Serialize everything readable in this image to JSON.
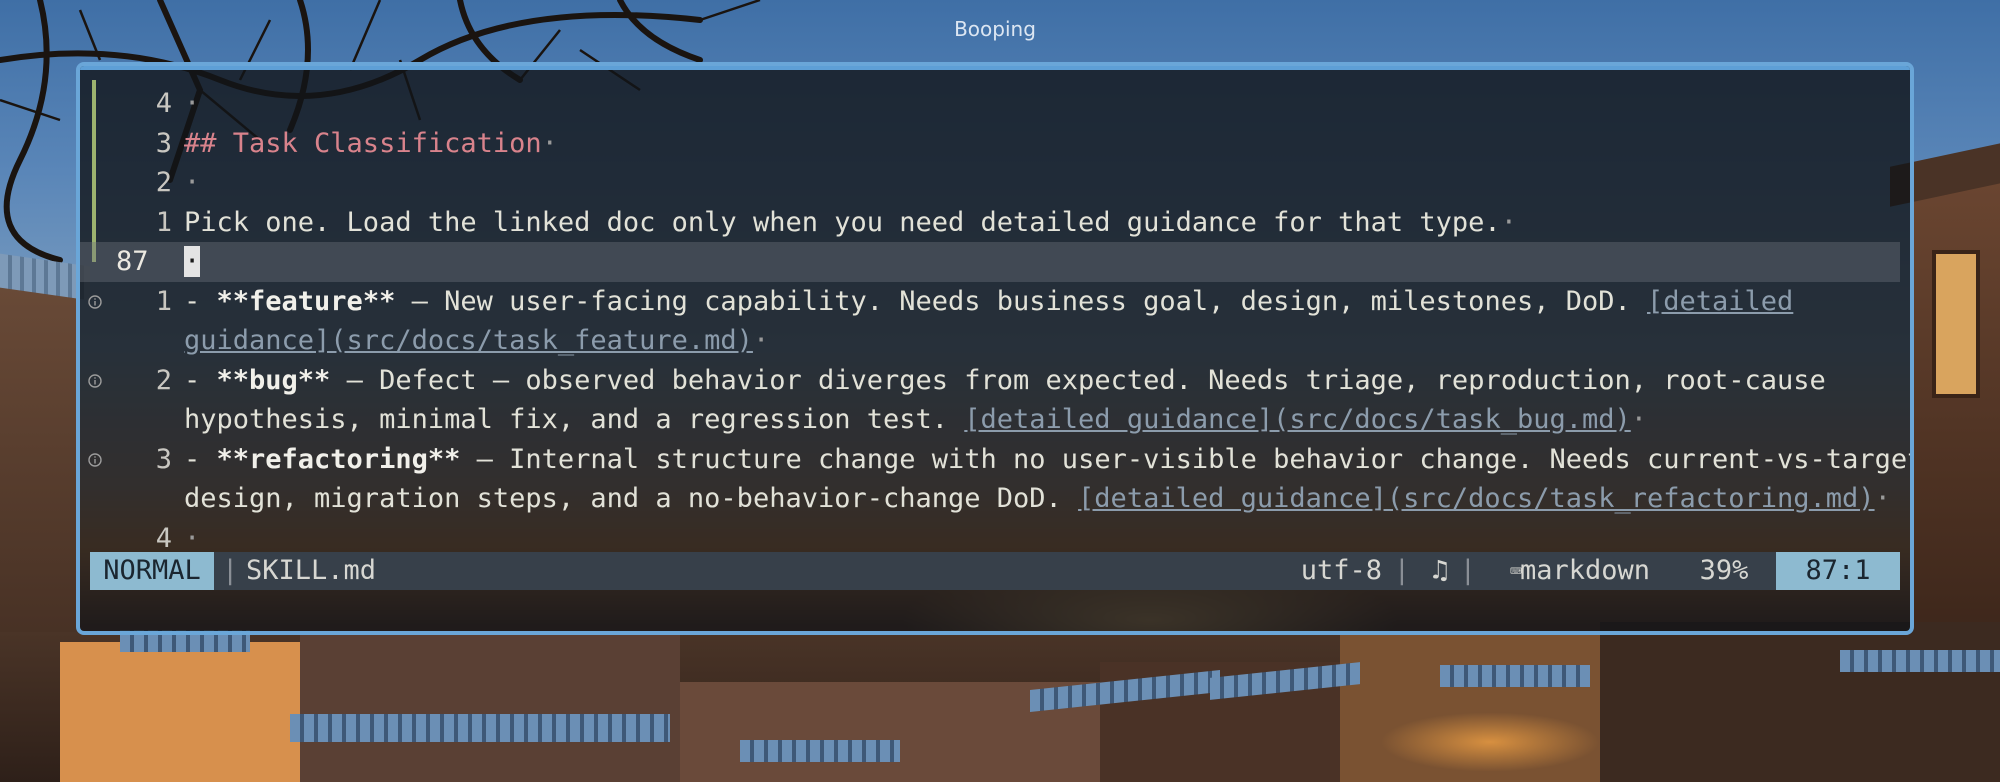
{
  "window": {
    "title": "Booping"
  },
  "editor": {
    "lines": [
      {
        "num": "4",
        "kind": "relative",
        "parts": [
          {
            "t": "·",
            "c": "ws"
          }
        ]
      },
      {
        "num": "3",
        "kind": "relative",
        "parts": [
          {
            "t": "## Task Classification",
            "c": "heading"
          },
          {
            "t": "·",
            "c": "ws"
          }
        ]
      },
      {
        "num": "2",
        "kind": "relative",
        "parts": [
          {
            "t": "·",
            "c": "ws"
          }
        ]
      },
      {
        "num": "1",
        "kind": "relative",
        "parts": [
          {
            "t": "Pick one. Load the linked doc only when you need detailed guidance for that type.",
            "c": ""
          },
          {
            "t": "·",
            "c": "ws"
          }
        ]
      },
      {
        "num": "87",
        "kind": "current",
        "parts": [
          {
            "t": "·",
            "c": "cursor"
          }
        ]
      },
      {
        "num": "1",
        "kind": "relative",
        "sign": "i",
        "parts": [
          {
            "t": "- ",
            "c": ""
          },
          {
            "t": "**feature**",
            "c": "bold"
          },
          {
            "t": " — New user-facing capability. Needs business goal, design, milestones, DoD. ",
            "c": ""
          },
          {
            "t": "[detailed",
            "c": "link"
          }
        ]
      },
      {
        "num": "",
        "kind": "wrap",
        "parts": [
          {
            "t": "guidance](src/docs/task_feature.md)",
            "c": "link"
          },
          {
            "t": "·",
            "c": "ws"
          }
        ]
      },
      {
        "num": "2",
        "kind": "relative",
        "sign": "i",
        "parts": [
          {
            "t": "- ",
            "c": ""
          },
          {
            "t": "**bug**",
            "c": "bold"
          },
          {
            "t": " — Defect — observed behavior diverges from expected. Needs triage, reproduction, root-cause",
            "c": ""
          }
        ]
      },
      {
        "num": "",
        "kind": "wrap",
        "parts": [
          {
            "t": "hypothesis, minimal fix, and a regression test. ",
            "c": ""
          },
          {
            "t": "[detailed guidance](src/docs/task_bug.md)",
            "c": "link"
          },
          {
            "t": "·",
            "c": "ws"
          }
        ]
      },
      {
        "num": "3",
        "kind": "relative",
        "sign": "i",
        "parts": [
          {
            "t": "- ",
            "c": ""
          },
          {
            "t": "**refactoring**",
            "c": "bold"
          },
          {
            "t": " — Internal structure change with no user-visible behavior change. Needs current-vs-target",
            "c": ""
          }
        ]
      },
      {
        "num": "",
        "kind": "wrap",
        "parts": [
          {
            "t": "design, migration steps, and a no-behavior-change DoD. ",
            "c": ""
          },
          {
            "t": "[detailed guidance](src/docs/task_refactoring.md)",
            "c": "link"
          },
          {
            "t": "·",
            "c": "ws"
          }
        ]
      },
      {
        "num": "4",
        "kind": "relative",
        "parts": [
          {
            "t": "·",
            "c": "ws"
          }
        ]
      }
    ]
  },
  "statusline": {
    "mode": "NORMAL",
    "separator": "|",
    "filename": "SKILL.md",
    "encoding": "utf-8",
    "os_icon": "♫",
    "filetype_icon": "⌨",
    "filetype": "markdown",
    "percent": "39%",
    "position": "87:1"
  },
  "icons": {
    "diagnostic_sign": "info-circle-icon",
    "os": "linux-tux-icon",
    "filetype": "markdown-icon"
  }
}
